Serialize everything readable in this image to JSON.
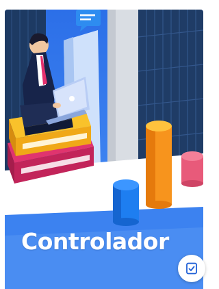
{
  "card": {
    "title": "Controlador",
    "illustration_icon": "businessman-laptop-chart-illustration",
    "action_icon": "checklist-icon",
    "colors": {
      "background_blue": "#3c82f0",
      "bar_orange": "#f7941d",
      "bar_blue": "#1e7ef0",
      "bar_pink": "#e85a7a",
      "books_yellow": "#f9c22b",
      "books_pink": "#e0346e"
    }
  }
}
